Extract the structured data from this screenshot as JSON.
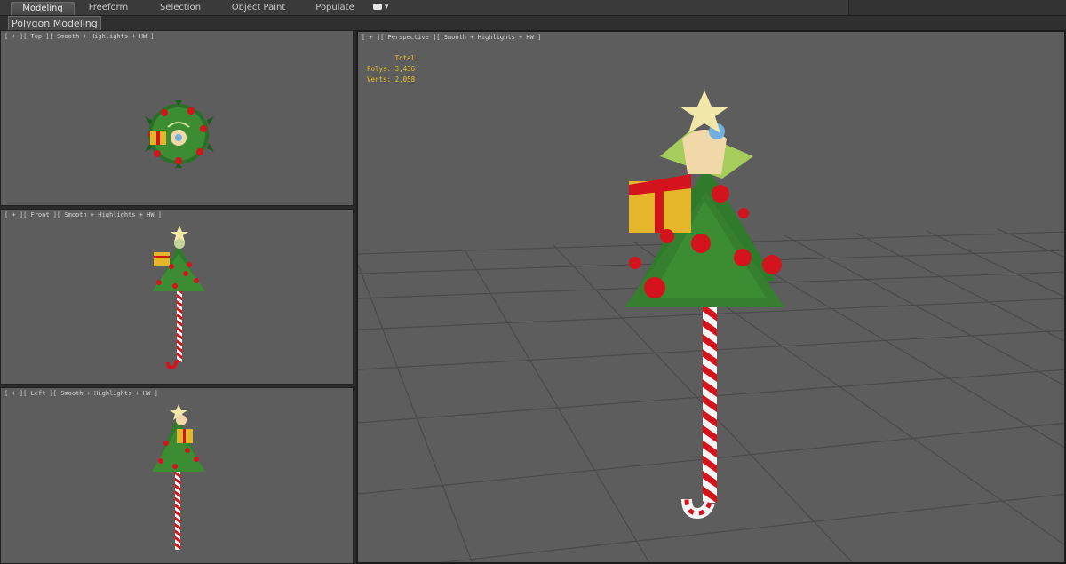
{
  "ribbon": {
    "tabs": [
      {
        "label": "Modeling",
        "active": true
      },
      {
        "label": "Freeform",
        "active": false
      },
      {
        "label": "Selection",
        "active": false
      },
      {
        "label": "Object Paint",
        "active": false
      },
      {
        "label": "Populate",
        "active": false
      }
    ],
    "panel_label": "Polygon Modeling"
  },
  "viewports": {
    "top": {
      "label": "[ + ][ Top ][ Smooth + Highlights + HW ]"
    },
    "front": {
      "label": "[ + ][ Front ][ Smooth + Highlights + HW ]"
    },
    "left": {
      "label": "[ + ][ Left ][ Smooth + Highlights + HW ]"
    },
    "perspective": {
      "label": "[ + ][ Perspective ][ Smooth + Highlights + HW ]",
      "stats": {
        "header": "Total",
        "polys_label": "Polys:",
        "polys_value": "3,436",
        "verts_label": "Verts:",
        "verts_value": "2,058"
      }
    }
  },
  "colors": {
    "viewport_bg": "#5d5d5d",
    "grid": "#474747",
    "stats": "#e6c12c",
    "tree_green": "#2f7a2b",
    "ornament_red": "#d4141c",
    "gift_yellow": "#e5b52a",
    "star": "#f1e7a8"
  }
}
